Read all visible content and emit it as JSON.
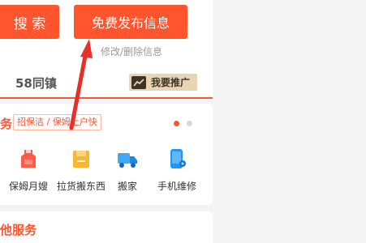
{
  "header": {
    "search_label": "搜 索",
    "publish_label": "免费发布信息",
    "modify_label": "修改/删除信息"
  },
  "location": {
    "town_label": "58同镇",
    "promote_label": "我要推广",
    "promote_icon": "trend-chart-icon"
  },
  "service_card": {
    "title": "务",
    "tags": "招保洁 / 保姆上户快",
    "accent_color": "#ff552e",
    "items": [
      {
        "label": "保姆月嫂",
        "icon": "nanny-apron-icon"
      },
      {
        "label": "拉货搬东西",
        "icon": "box-icon"
      },
      {
        "label": "搬家",
        "icon": "moving-truck-icon"
      },
      {
        "label": "手机维修",
        "icon": "phone-repair-icon"
      }
    ]
  },
  "other_card": {
    "title": "他服务"
  }
}
